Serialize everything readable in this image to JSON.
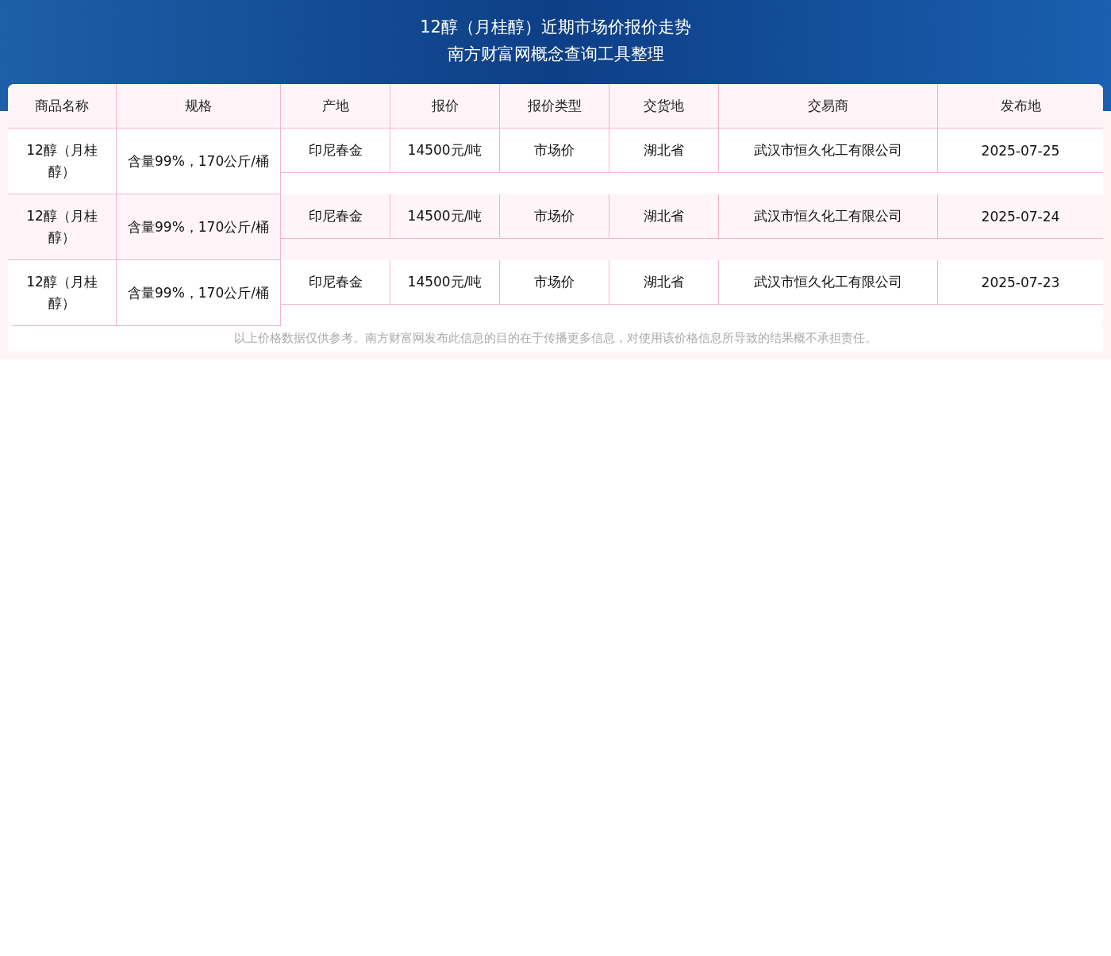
{
  "title": "12醇（月桂醇）近期市场价报价走势",
  "subtitle": "南方财富网概念查询工具整理",
  "table": {
    "columns": [
      "商品名称",
      "规格",
      "产地",
      "报价",
      "报价类型",
      "交货地",
      "交易商",
      "发布地"
    ],
    "rows": [
      [
        "12醇（月桂醇）",
        "含量99%，170公斤/桶",
        "印尼春金",
        "14500元/吨",
        "市场价",
        "湖北省",
        "武汉市恒久化工有限公司",
        "2025-07-25"
      ],
      [
        "12醇（月桂醇）",
        "含量99%，170公斤/桶",
        "印尼春金",
        "14500元/吨",
        "市场价",
        "湖北省",
        "武汉市恒久化工有限公司",
        "2025-07-24"
      ],
      [
        "12醇（月桂醇）",
        "含量99%，170公斤/桶",
        "印尼春金",
        "14500元/吨",
        "市场价",
        "湖北省",
        "武汉市恒久化工有限公司",
        "2025-07-23"
      ]
    ]
  },
  "disclaimer": "以上价格数据仅供参考。南方财富网发布此信息的目的在于传播更多信息，对使用该价格信息所导致的结果概不承担责任。"
}
